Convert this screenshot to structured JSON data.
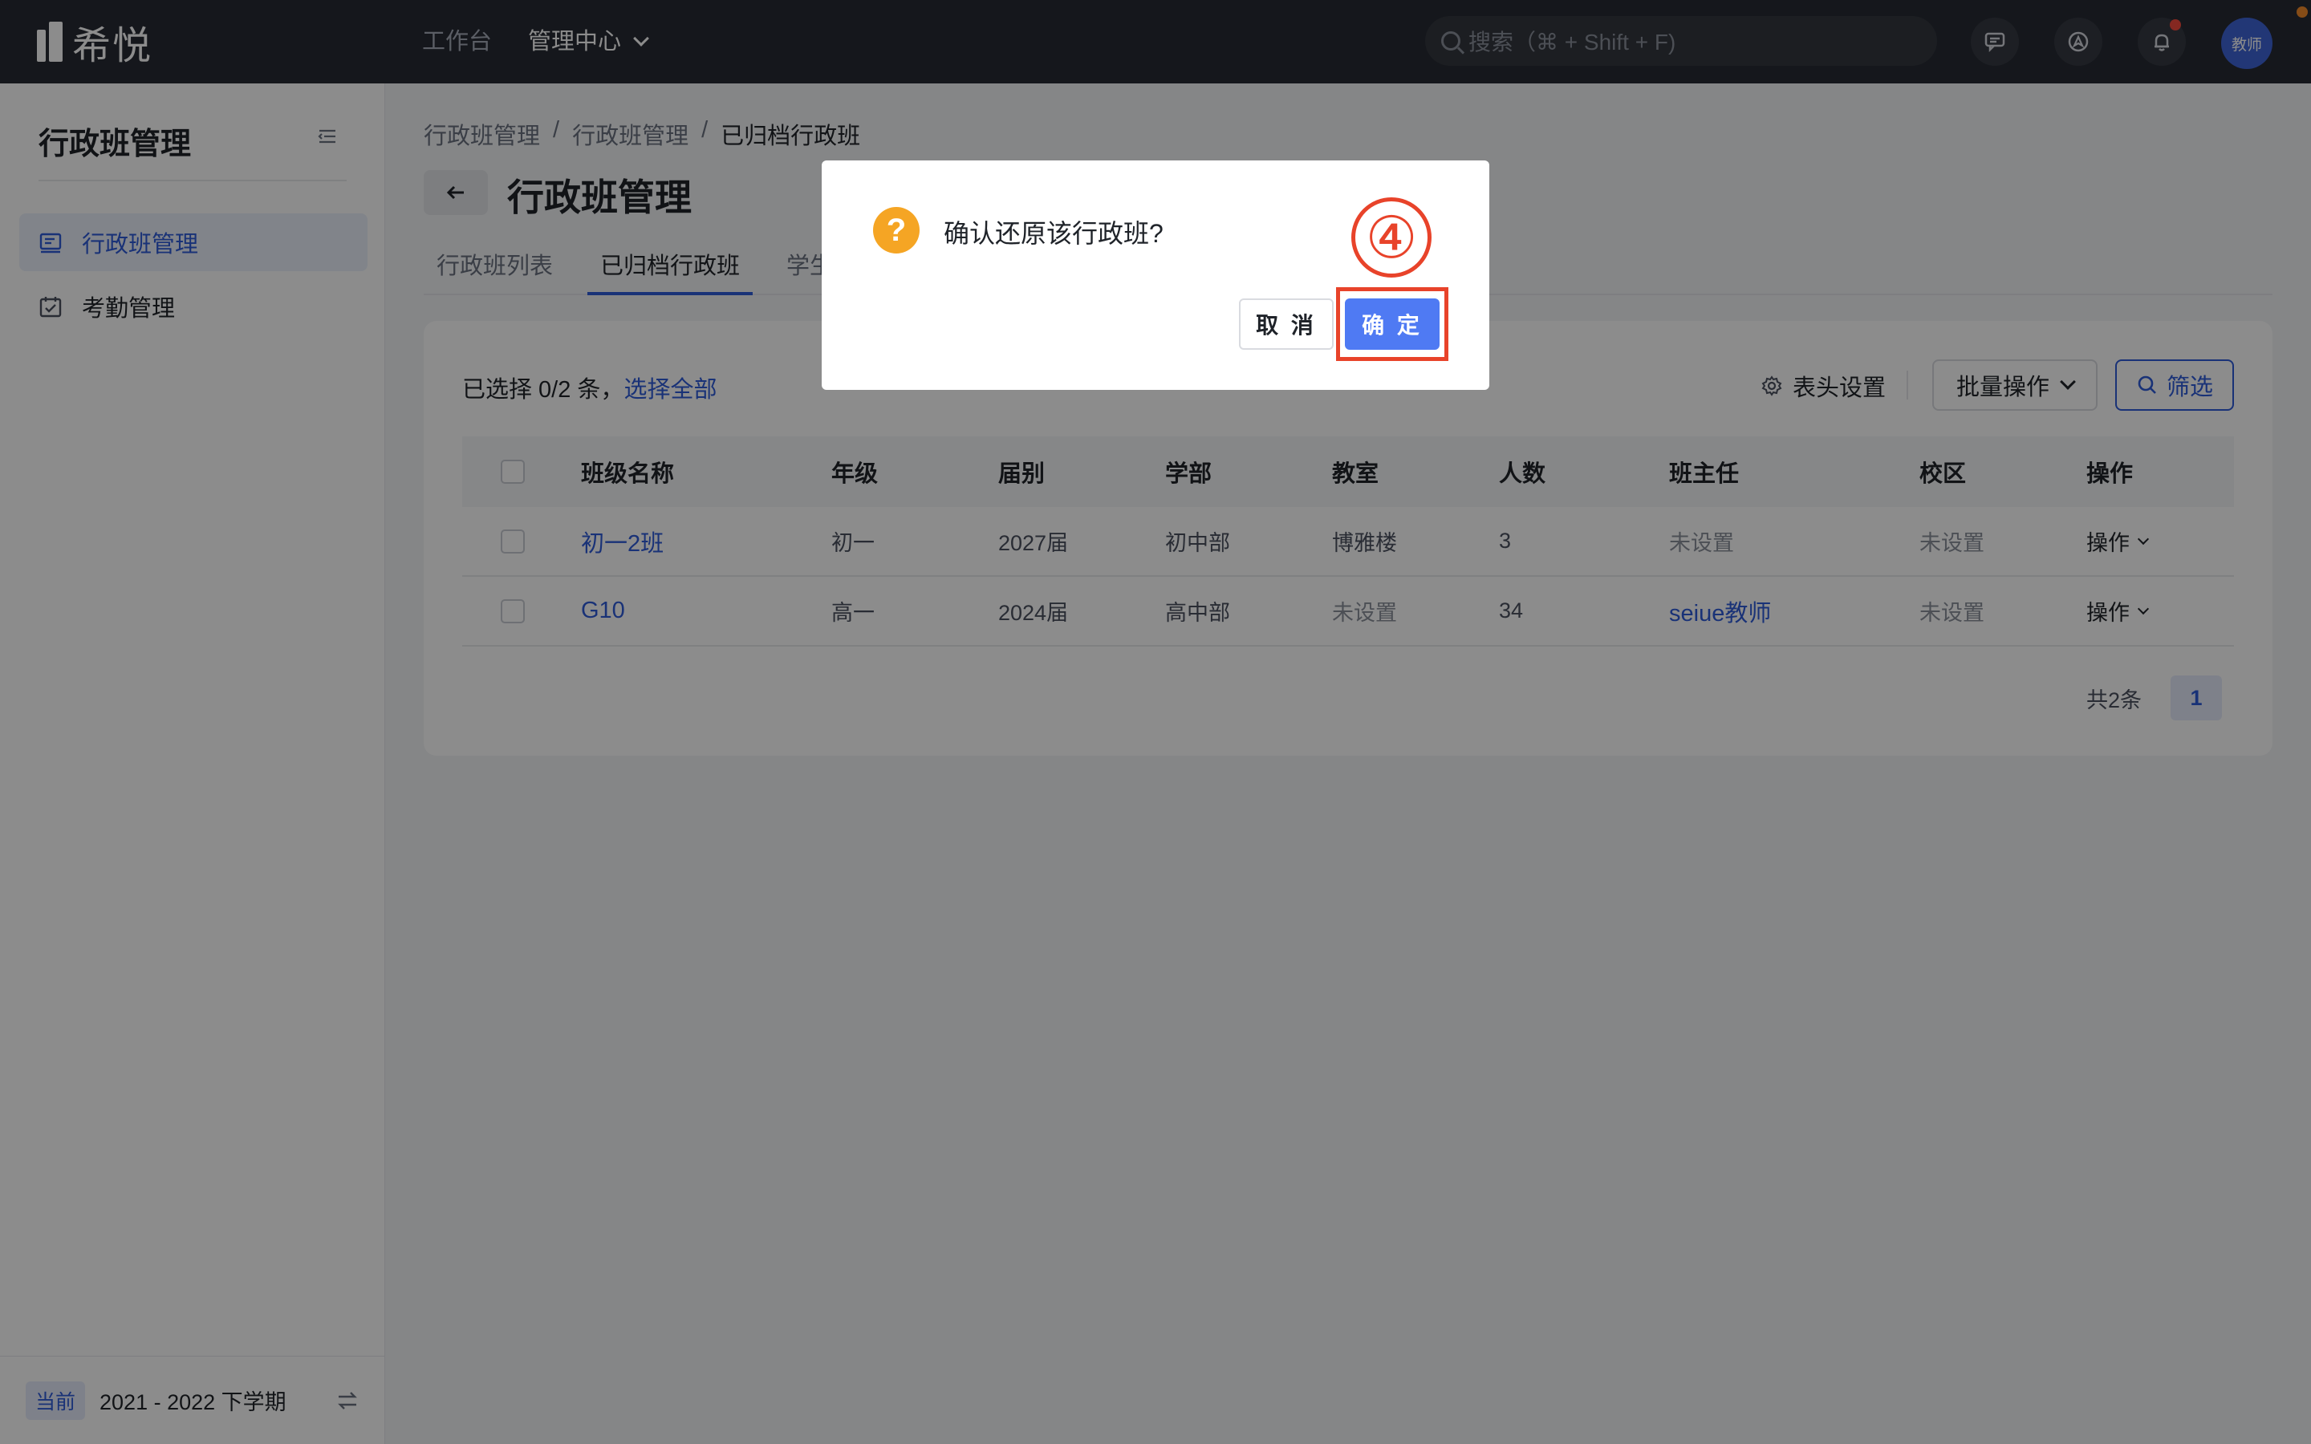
{
  "brand": {
    "name": "希悦"
  },
  "topnav": {
    "workbench": "工作台",
    "admin_center": "管理中心"
  },
  "search": {
    "placeholder": "搜索（⌘ + Shift + F)"
  },
  "user": {
    "avatar_text": "教师"
  },
  "sidebar": {
    "title": "行政班管理",
    "items": [
      {
        "label": "行政班管理",
        "icon": "class-list-icon",
        "active": true
      },
      {
        "label": "考勤管理",
        "icon": "calendar-check-icon",
        "active": false
      }
    ],
    "footer": {
      "badge": "当前",
      "term": "2021 - 2022 下学期"
    }
  },
  "breadcrumb": [
    "行政班管理",
    "行政班管理",
    "已归档行政班"
  ],
  "breadcrumb_sep": "/",
  "page": {
    "title": "行政班管理"
  },
  "tabs": [
    {
      "label": "行政班列表",
      "active": false
    },
    {
      "label": "已归档行政班",
      "active": true
    },
    {
      "label": "学生",
      "active": false
    }
  ],
  "toolbar": {
    "selected_prefix": "已选择 0/2 条，",
    "select_all": "选择全部",
    "column_settings": "表头设置",
    "batch_ops": "批量操作",
    "filter": "筛选"
  },
  "table": {
    "columns": [
      "班级名称",
      "年级",
      "届别",
      "学部",
      "教室",
      "人数",
      "班主任",
      "校区",
      "操作"
    ],
    "rows": [
      {
        "name": "初一2班",
        "grade": "初一",
        "cohort": "2027届",
        "division": "初中部",
        "classroom": "博雅楼",
        "count": "3",
        "teacher": "未设置",
        "campus": "未设置",
        "action": "操作"
      },
      {
        "name": "G10",
        "grade": "高一",
        "cohort": "2024届",
        "division": "高中部",
        "classroom": "未设置",
        "count": "34",
        "teacher": "seiue教师",
        "campus": "未设置",
        "action": "操作"
      }
    ]
  },
  "pagination": {
    "total": "共2条",
    "current": "1"
  },
  "modal": {
    "message": "确认还原该行政班?",
    "cancel": "取 消",
    "confirm": "确 定",
    "step_marker": "④"
  },
  "colors": {
    "accent": "#2f5bd9",
    "confirm": "#4f7af3",
    "warning": "#f5a524",
    "annotation": "#e8432a",
    "topbar": "#272b33"
  }
}
